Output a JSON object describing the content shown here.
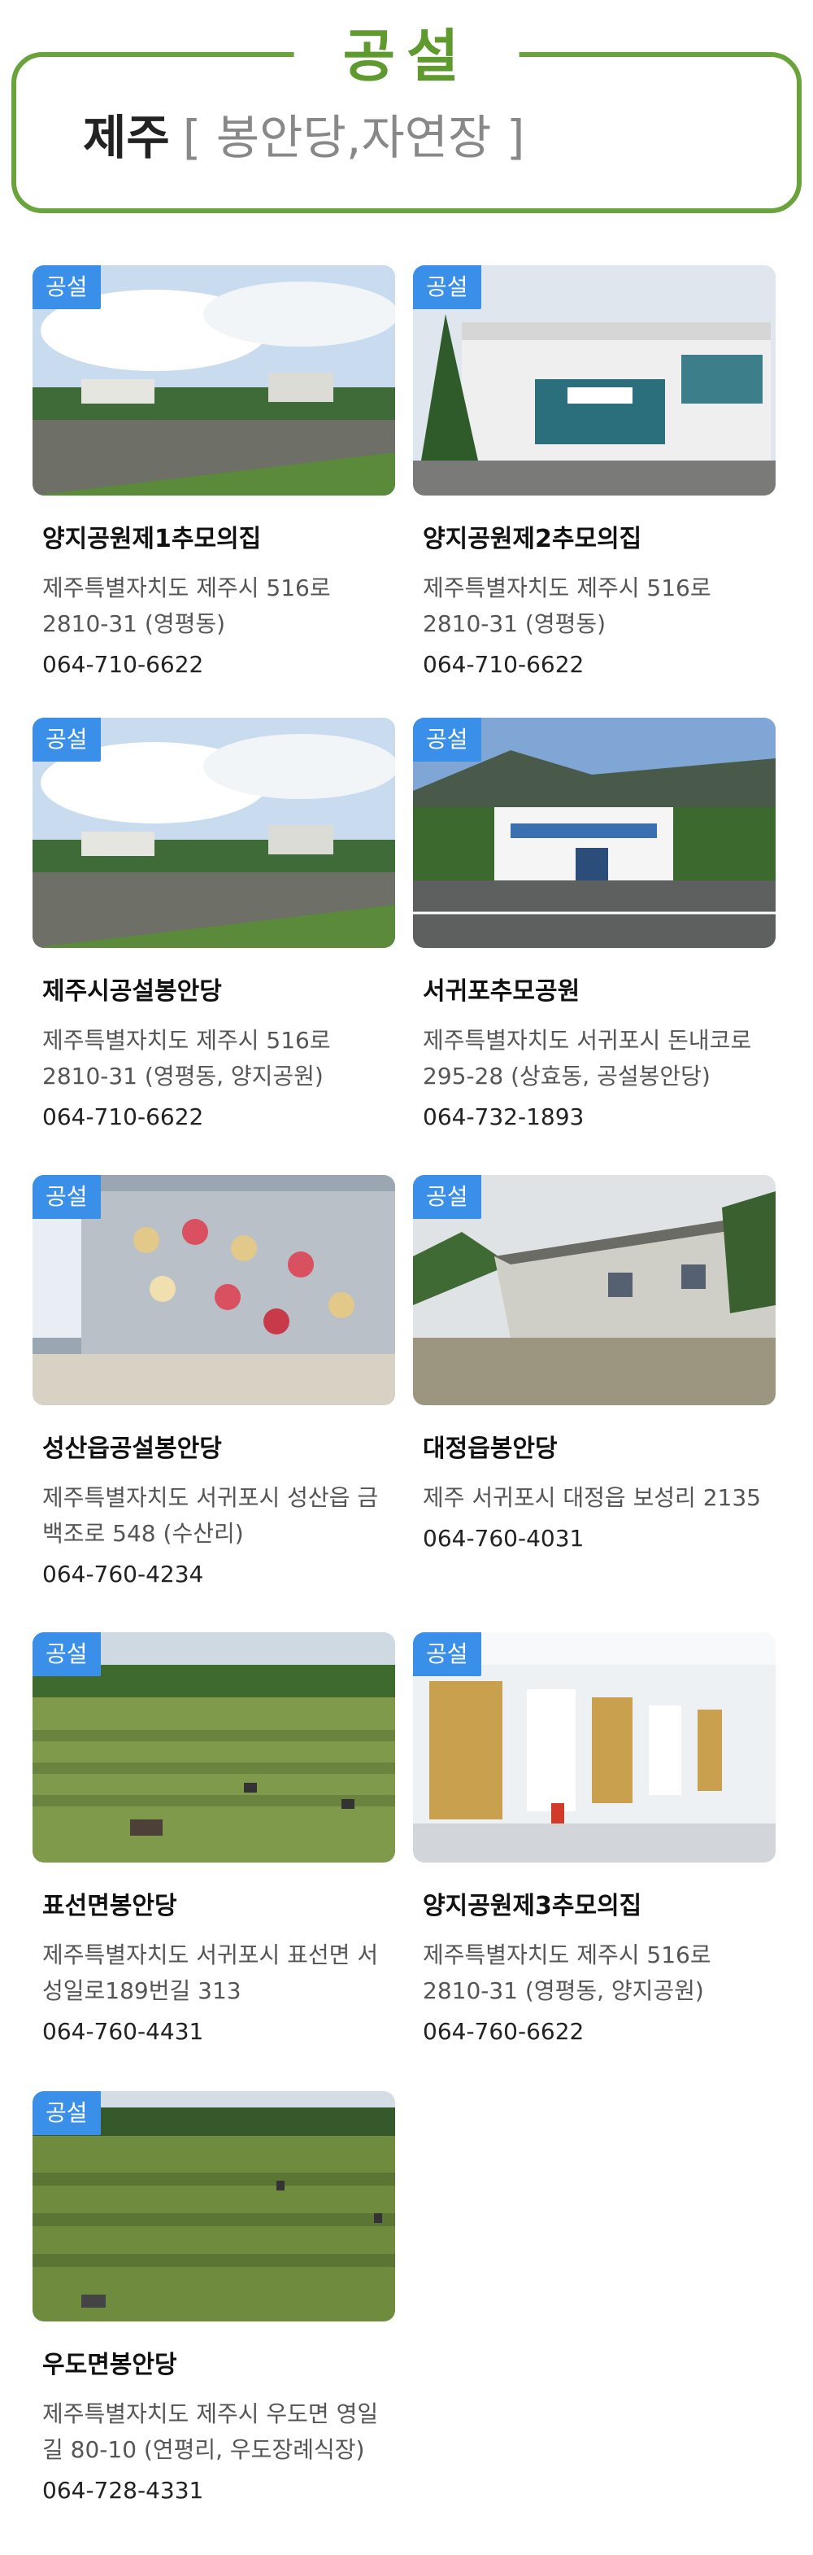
{
  "header": {
    "tab_label": "공설",
    "region": "제주",
    "subtitle": "[ 봉안당,자연장 ]"
  },
  "cards": [
    {
      "badge": "공설",
      "name": "양지공원제1추모의집",
      "address": "제주특별자치도 제주시 516로 2810-31 (영평동)",
      "phone": "064-710-6622"
    },
    {
      "badge": "공설",
      "name": "양지공원제2추모의집",
      "address": "제주특별자치도 제주시 516로 2810-31 (영평동)",
      "phone": "064-710-6622"
    },
    {
      "badge": "공설",
      "name": "제주시공설봉안당",
      "address": "제주특별자치도 제주시 516로 2810-31 (영평동, 양지공원)",
      "phone": "064-710-6622"
    },
    {
      "badge": "공설",
      "name": "서귀포추모공원",
      "address": "제주특별자치도 서귀포시 돈내코로 295-28 (상효동, 공설봉안당)",
      "phone": "064-732-1893"
    },
    {
      "badge": "공설",
      "name": "성산읍공설봉안당",
      "address": "제주특별자치도 서귀포시 성산읍 금백조로 548 (수산리)",
      "phone": "064-760-4234"
    },
    {
      "badge": "공설",
      "name": "대정읍봉안당",
      "address": "제주 서귀포시 대정읍 보성리 2135",
      "phone": "064-760-4031"
    },
    {
      "badge": "공설",
      "name": "표선면봉안당",
      "address": "제주특별자치도 서귀포시 표선면 서성일로189번길 313",
      "phone": "064-760-4431"
    },
    {
      "badge": "공설",
      "name": "양지공원제3추모의집",
      "address": "제주특별자치도 제주시 516로 2810-31 (영평동, 양지공원)",
      "phone": "064-760-6622"
    },
    {
      "badge": "공설",
      "name": "우도면봉안당",
      "address": "제주특별자치도 제주시 우도면 영일길 80-10 (연평리, 우도장례식장)",
      "phone": "064-728-4331"
    }
  ],
  "colors": {
    "accent_green": "#6aa33c",
    "badge_blue": "#3a8fe8"
  },
  "icons": [
    "photo-park-building",
    "photo-memorial-building",
    "photo-park-building",
    "photo-hillside-building",
    "photo-wreath-wall",
    "photo-rural-building",
    "photo-grass-field",
    "photo-ossuary-interior",
    "photo-grass-field"
  ]
}
